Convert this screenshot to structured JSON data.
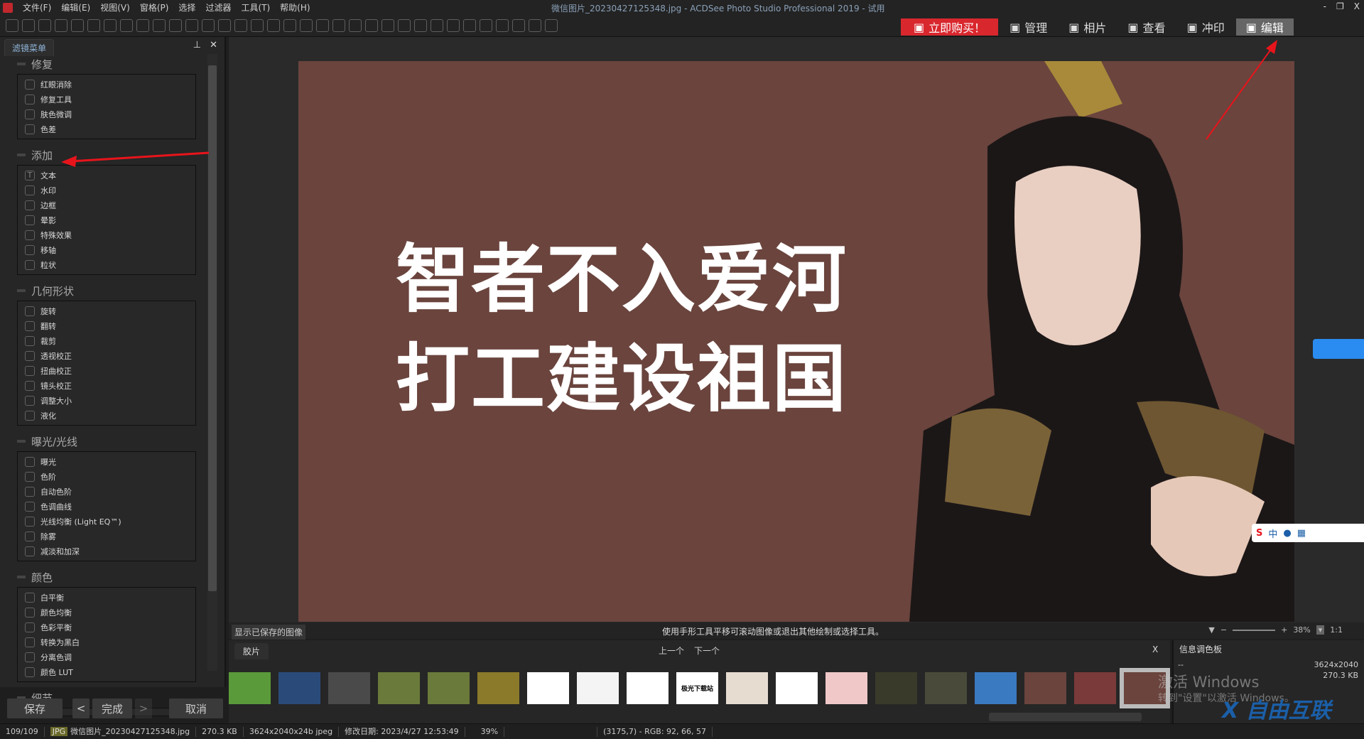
{
  "menu": {
    "items": [
      "文件(F)",
      "编辑(E)",
      "视图(V)",
      "窗格(P)",
      "选择",
      "过滤器",
      "工具(T)",
      "帮助(H)"
    ]
  },
  "window": {
    "title": "微信图片_20230427125348.jpg - ACDSee Photo Studio Professional 2019 - 试用",
    "controls": [
      "-",
      "❐",
      "X"
    ]
  },
  "modes": [
    {
      "label": "立即购买！",
      "icon": "cart-icon"
    },
    {
      "label": "管理",
      "icon": "grid-icon"
    },
    {
      "label": "相片",
      "icon": "photos-icon"
    },
    {
      "label": "查看",
      "icon": "eye-icon"
    },
    {
      "label": "冲印",
      "icon": "print-icon"
    },
    {
      "label": "编辑",
      "icon": "edit-tools-icon",
      "active": true
    }
  ],
  "colors": {
    "buy": "#d9272e",
    "photo_bg": "#6a443d",
    "arrow": "#e8141b",
    "accent_tab": "#8fb4d8"
  },
  "left_panel": {
    "tab": "滤镜菜单",
    "groups": [
      {
        "title": "修复",
        "items": [
          "红眼消除",
          "修复工具",
          "肤色微调",
          "色差"
        ]
      },
      {
        "title": "添加",
        "items": [
          "文本",
          "水印",
          "边框",
          "晕影",
          "特殊效果",
          "移轴",
          "粒状"
        ]
      },
      {
        "title": "几何形状",
        "items": [
          "旋转",
          "翻转",
          "裁剪",
          "透视校正",
          "扭曲校正",
          "镜头校正",
          "调整大小",
          "液化"
        ]
      },
      {
        "title": "曝光/光线",
        "items": [
          "曝光",
          "色阶",
          "自动色阶",
          "色调曲线",
          "光线均衡 (Light EQ™)",
          "除雾",
          "减淡和加深"
        ]
      },
      {
        "title": "颜色",
        "items": [
          "白平衡",
          "颜色均衡",
          "色彩平衡",
          "转换为黑白",
          "分离色调",
          "颜色 LUT"
        ]
      },
      {
        "title": "细节",
        "items": []
      }
    ],
    "buttons": {
      "save": "保存",
      "prev": "<",
      "done": "完成",
      "next": ">",
      "cancel": "取消"
    }
  },
  "photo": {
    "line1": "智者不入爱河",
    "line2": "打工建设祖国"
  },
  "infobar": {
    "show_saved": "显示已保存的图像",
    "hint": "使用手形工具平移可滚动图像或退出其他绘制或选择工具。",
    "zoom": "38%",
    "one_to_one": "1:1"
  },
  "film": {
    "tab": "胶片",
    "prev": "上一个",
    "next": "下一个",
    "close": "X",
    "thumbs": [
      {
        "c": "#5a9a3a"
      },
      {
        "c": "#2a4a7a"
      },
      {
        "c": "#4a4a4a"
      },
      {
        "c": "#6a7a3a"
      },
      {
        "c": "#6a7a3a"
      },
      {
        "c": "#8a7a2a"
      },
      {
        "c": "#ffffff"
      },
      {
        "c": "#f4f4f4"
      },
      {
        "c": "#ffffff"
      },
      {
        "c": "#ffffff",
        "t": "极光下载站"
      },
      {
        "c": "#e6dcd0"
      },
      {
        "c": "#ffffff"
      },
      {
        "c": "#f0c8c8"
      },
      {
        "c": "#3a3a2a"
      },
      {
        "c": "#4a4a3a"
      },
      {
        "c": "#3a7ac0"
      },
      {
        "c": "#6a443d"
      },
      {
        "c": "#7a3a3a"
      },
      {
        "c": "#6a443d"
      }
    ]
  },
  "info_palette": {
    "tab": "信息调色板",
    "dims": "3624x2040",
    "size": "270.3 KB",
    "dash": "--"
  },
  "status": {
    "count": "109/109",
    "type": "JPG",
    "file": "微信图片_20230427125348.jpg",
    "size": "270.3 KB",
    "dims": "3624x2040x24b jpeg",
    "modified": "修改日期: 2023/4/27 12:53:49",
    "zoom": "39%",
    "pixel": "(3175,7) - RGB: 92, 66, 57"
  },
  "overlay": {
    "activate1": "激活 Windows",
    "activate2": "转到\"设置\"以激活 Windows。",
    "site": "自由互联",
    "ime": "中"
  }
}
